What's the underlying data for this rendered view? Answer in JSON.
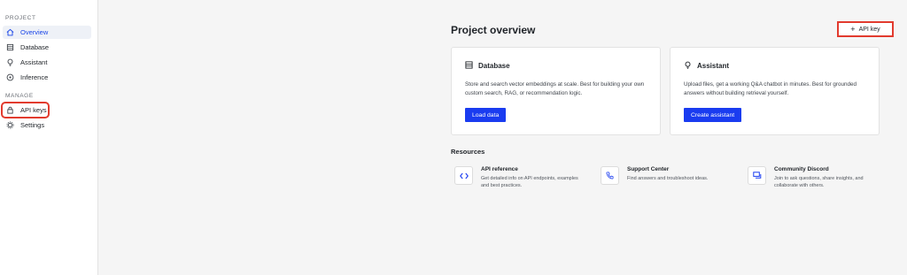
{
  "sidebar": {
    "project_label": "PROJECT",
    "manage_label": "MANAGE",
    "items": [
      {
        "label": "Overview",
        "icon": "home-icon"
      },
      {
        "label": "Database",
        "icon": "database-icon"
      },
      {
        "label": "Assistant",
        "icon": "lightbulb-icon"
      },
      {
        "label": "Inference",
        "icon": "inference-icon"
      },
      {
        "label": "API keys",
        "icon": "lock-icon"
      },
      {
        "label": "Settings",
        "icon": "gear-icon"
      }
    ]
  },
  "main": {
    "title": "Project overview",
    "api_key_button": {
      "plus": "+",
      "label": "API key"
    },
    "cards": [
      {
        "title": "Database",
        "icon": "database-icon",
        "description": "Store and search vector embeddings at scale. Best for building your own custom search, RAG, or recommendation logic.",
        "button": "Load data"
      },
      {
        "title": "Assistant",
        "icon": "lightbulb-icon",
        "description": "Upload files, get a working Q&A chatbot in minutes. Best for grounded answers without building retrieval yourself.",
        "button": "Create assistant"
      }
    ],
    "resources_title": "Resources",
    "resources": [
      {
        "title": "API reference",
        "icon": "code-icon",
        "description": "Get detailed info on API endpoints, examples and best practices."
      },
      {
        "title": "Support Center",
        "icon": "phone-icon",
        "description": "Find answers and troubleshoot ideas."
      },
      {
        "title": "Community Discord",
        "icon": "chat-icon",
        "description": "Join to ask questions, share insights, and collaborate with others."
      }
    ]
  },
  "colors": {
    "accent": "#1a3cf0",
    "active_nav": "#1a46e8",
    "highlight": "#e23b2e"
  }
}
